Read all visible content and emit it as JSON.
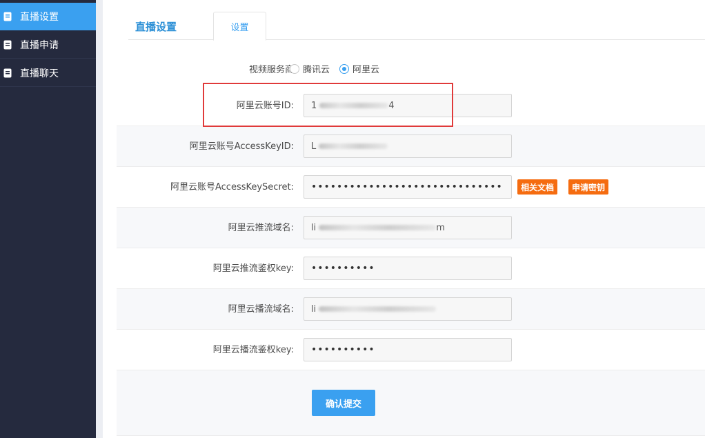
{
  "sidebar": {
    "items": [
      {
        "label": "直播设置",
        "icon": "document-icon",
        "active": true
      },
      {
        "label": "直播申请",
        "icon": "document-icon",
        "active": false
      },
      {
        "label": "直播聊天",
        "icon": "document-icon",
        "active": false
      }
    ]
  },
  "header": {
    "title": "直播设置",
    "tab_settings": "设置"
  },
  "form": {
    "provider_label": "视频服务商",
    "provider_options": [
      "腾讯云",
      "阿里云"
    ],
    "provider_selected": "阿里云",
    "account_id_label": "阿里云账号ID:",
    "account_id_value": "1",
    "account_id_value_tail": "4",
    "access_key_id_label": "阿里云账号AccessKeyID:",
    "access_key_id_value": "L",
    "access_key_secret_label": "阿里云账号AccessKeySecret:",
    "access_key_secret_value": "••••••••••••••••••••••••••••••",
    "docs_button": "相关文档",
    "apply_key_button": "申请密钥",
    "push_domain_label": "阿里云推流域名:",
    "push_domain_value": "li",
    "push_domain_tail": "m",
    "push_auth_key_label": "阿里云推流鉴权key:",
    "push_auth_key_value": "••••••••••",
    "play_domain_label": "阿里云播流域名:",
    "play_domain_value": "li",
    "play_auth_key_label": "阿里云播流鉴权key:",
    "play_auth_key_value": "••••••••••",
    "submit_label": "确认提交"
  },
  "colors": {
    "sidebar_bg": "#252a3e",
    "accent": "#3aa0f0",
    "orange": "#f56c10",
    "highlight": "#e03a3a"
  }
}
